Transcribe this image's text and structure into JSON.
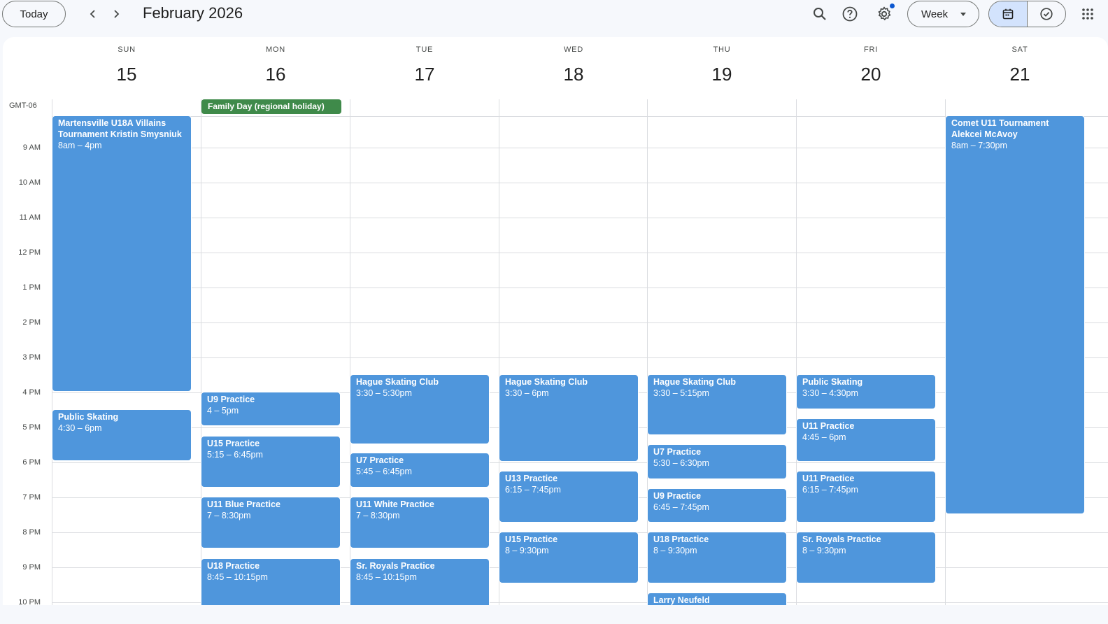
{
  "toolbar": {
    "today_label": "Today",
    "title": "February 2026",
    "view_label": "Week",
    "icons": [
      "chevron-left-icon",
      "chevron-right-icon",
      "search-icon",
      "help-icon",
      "settings-icon",
      "calendar-icon",
      "tasks-check-icon",
      "apps-grid-icon"
    ]
  },
  "timezone": "GMT-06",
  "days": [
    {
      "dow": "SUN",
      "num": "15"
    },
    {
      "dow": "MON",
      "num": "16"
    },
    {
      "dow": "TUE",
      "num": "17"
    },
    {
      "dow": "WED",
      "num": "18"
    },
    {
      "dow": "THU",
      "num": "19"
    },
    {
      "dow": "FRI",
      "num": "20"
    },
    {
      "dow": "SAT",
      "num": "21"
    }
  ],
  "hours": [
    "9 AM",
    "10 AM",
    "11 AM",
    "12 PM",
    "1 PM",
    "2 PM",
    "3 PM",
    "4 PM",
    "5 PM",
    "6 PM",
    "7 PM",
    "8 PM",
    "9 PM",
    "10 PM"
  ],
  "all_day": {
    "holiday": "Family Day (regional holiday)"
  },
  "colors": {
    "event": "#4f96dc",
    "holiday": "#3f8a4a",
    "selected_view": "#d3e3fd"
  },
  "events": {
    "sun_tournament": {
      "title": "Martensville U18A Villains Tournament Kristin Smysniuk",
      "time": "8am – 4pm"
    },
    "sun_public": {
      "title": "Public Skating",
      "time": "4:30 – 6pm"
    },
    "mon_u9": {
      "title": "U9 Practice",
      "time": "4 – 5pm"
    },
    "mon_u15": {
      "title": "U15 Practice",
      "time": "5:15 – 6:45pm"
    },
    "mon_u11blue": {
      "title": "U11 Blue Practice",
      "time": "7 – 8:30pm"
    },
    "mon_u18": {
      "title": "U18 Practice",
      "time": "8:45 – 10:15pm"
    },
    "tue_hague": {
      "title": "Hague Skating Club",
      "time": "3:30 – 5:30pm"
    },
    "tue_u7": {
      "title": "U7 Practice",
      "time": "5:45 – 6:45pm"
    },
    "tue_u11white": {
      "title": "U11 White Practice",
      "time": "7 – 8:30pm"
    },
    "tue_srroyals": {
      "title": "Sr. Royals Practice",
      "time": "8:45 – 10:15pm"
    },
    "wed_hague": {
      "title": "Hague Skating Club",
      "time": "3:30 – 6pm"
    },
    "wed_u13": {
      "title": "U13 Practice",
      "time": "6:15 – 7:45pm"
    },
    "wed_u15": {
      "title": "U15 Practice",
      "time": "8 – 9:30pm"
    },
    "thu_hague": {
      "title": "Hague Skating Club",
      "time": "3:30 – 5:15pm"
    },
    "thu_u7": {
      "title": "U7 Practice",
      "time": "5:30 – 6:30pm"
    },
    "thu_u9": {
      "title": "U9 Practice",
      "time": "6:45 – 7:45pm"
    },
    "thu_u18": {
      "title": "U18 Prtactice",
      "time": "8 – 9:30pm"
    },
    "thu_larry": {
      "title": "Larry Neufeld",
      "time": ""
    },
    "fri_public": {
      "title": "Public Skating",
      "time": "3:30 – 4:30pm"
    },
    "fri_u11a": {
      "title": "U11 Practice",
      "time": "4:45 – 6pm"
    },
    "fri_u11b": {
      "title": "U11 Practice",
      "time": "6:15 – 7:45pm"
    },
    "fri_srroyals": {
      "title": "Sr. Royals Practice",
      "time": "8 – 9:30pm"
    },
    "sat_comet": {
      "title": "Comet U11 Tournament Alekcei McAvoy",
      "time": "8am – 7:30pm"
    }
  }
}
